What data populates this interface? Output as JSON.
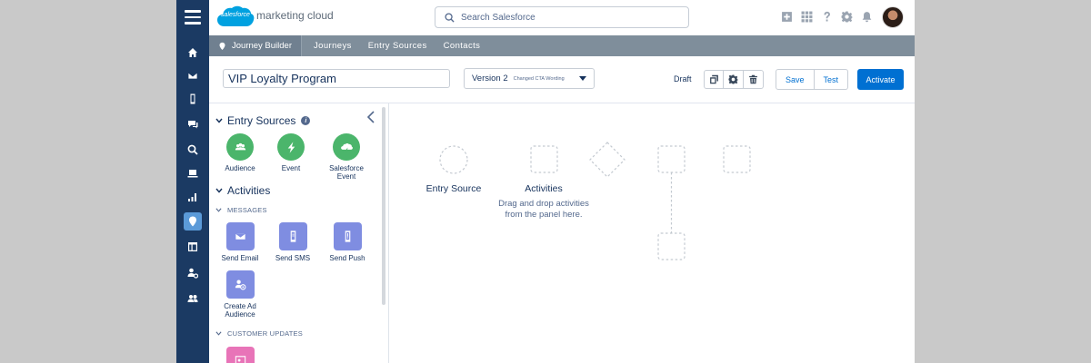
{
  "header": {
    "logo_text": "salesforce",
    "brand": "marketing cloud",
    "search_placeholder": "Search Salesforce",
    "icons": [
      "plus-icon",
      "app-launcher-icon",
      "help-icon",
      "gear-icon",
      "bell-icon"
    ]
  },
  "rail": {
    "items": [
      "home-icon",
      "mail-icon",
      "mobile-icon",
      "chat-icon",
      "search-analytics-icon",
      "laptop-icon",
      "bar-chart-icon",
      "journey-pin-icon",
      "layout-icon",
      "user-settings-icon",
      "group-icon"
    ],
    "active_index": 7
  },
  "nav": {
    "app_name": "Journey Builder",
    "tabs": [
      "Journeys",
      "Entry Sources",
      "Contacts"
    ]
  },
  "toolbar": {
    "journey_name": "VIP Loyalty Program",
    "version_label": "Version 2",
    "version_note": "Changed CTA Wording",
    "status": "Draft",
    "save_label": "Save",
    "test_label": "Test",
    "activate_label": "Activate"
  },
  "panel": {
    "entry_sources_title": "Entry Sources",
    "entry_sources": [
      {
        "label": "Audience",
        "icon": "audience-icon"
      },
      {
        "label": "Event",
        "icon": "lightning-icon"
      },
      {
        "label": "Salesforce Event",
        "icon": "cloud-event-icon"
      }
    ],
    "activities_title": "Activities",
    "messages_title": "MESSAGES",
    "messages": [
      {
        "label": "Send Email",
        "icon": "email-icon"
      },
      {
        "label": "Send SMS",
        "icon": "sms-icon"
      },
      {
        "label": "Send Push",
        "icon": "push-icon"
      },
      {
        "label": "Create Ad Audience",
        "icon": "ad-audience-icon"
      }
    ],
    "customer_updates_title": "CUSTOMER UPDATES"
  },
  "canvas": {
    "entry_source_label": "Entry Source",
    "activities_label": "Activities",
    "hint_line1": "Drag and drop activities",
    "hint_line2": "from the panel here."
  },
  "colors": {
    "rail": "#1b3a63",
    "nav": "#7f8e9b",
    "accent": "#0070d2",
    "entry_green": "#4bb56b",
    "message_purple": "#7f8de1",
    "update_pink": "#e874b8"
  }
}
